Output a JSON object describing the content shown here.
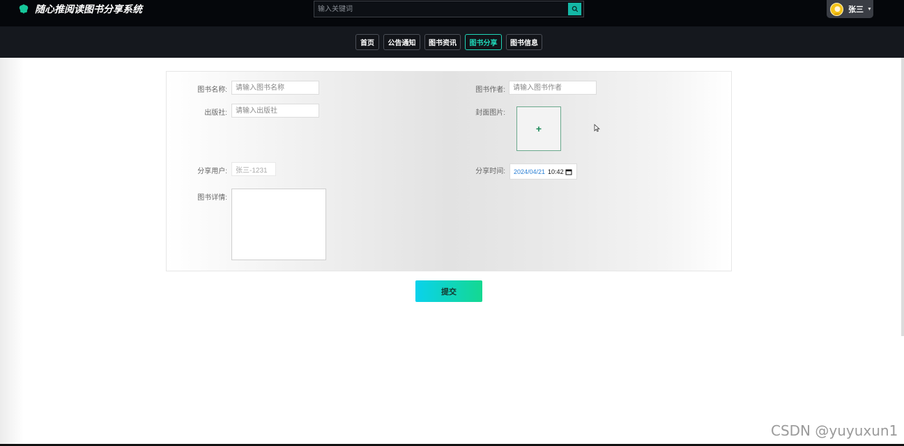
{
  "app": {
    "title": "随心推阅读图书分享系统"
  },
  "search": {
    "placeholder": "输入关键词"
  },
  "user": {
    "name": "张三"
  },
  "nav": {
    "items": [
      {
        "label": "首页",
        "active": false
      },
      {
        "label": "公告通知",
        "active": false
      },
      {
        "label": "图书资讯",
        "active": false
      },
      {
        "label": "图书分享",
        "active": true
      },
      {
        "label": "图书信息",
        "active": false
      }
    ]
  },
  "form": {
    "book_name": {
      "label": "图书名称:",
      "placeholder": "请输入图书名称"
    },
    "publisher": {
      "label": "出版社:",
      "placeholder": "请输入出版社"
    },
    "share_user": {
      "label": "分享用户:",
      "value": "张三-1231"
    },
    "details": {
      "label": "图书详情:"
    },
    "author": {
      "label": "图书作者:",
      "placeholder": "请输入图书作者"
    },
    "cover": {
      "label": "封面图片:",
      "add_symbol": "+"
    },
    "share_time": {
      "label": "分享时间:",
      "date": "2024/04/21",
      "time": "10:42"
    }
  },
  "submit": {
    "label": "提交"
  },
  "watermark": "CSDN @yuyuxun1",
  "colors": {
    "topbar": "#05070b",
    "navbar": "#15181e",
    "accent": "#1fd6b8",
    "submit_from": "#0ad2ec",
    "submit_to": "#14d891"
  },
  "icons": {
    "logo": "leaf-logo-icon",
    "search": "search-icon",
    "calendar": "calendar-icon",
    "caret": "caret-down-icon"
  }
}
